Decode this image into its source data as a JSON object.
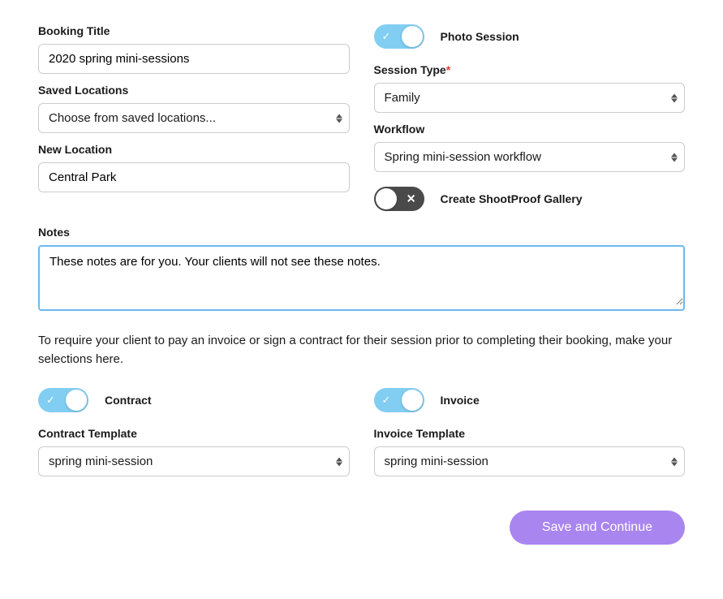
{
  "leftCol": {
    "bookingTitle": {
      "label": "Booking Title",
      "value": "2020 spring mini-sessions"
    },
    "savedLocations": {
      "label": "Saved Locations",
      "placeholder": "Choose from saved locations..."
    },
    "newLocation": {
      "label": "New Location",
      "value": "Central Park"
    }
  },
  "rightCol": {
    "photoSession": {
      "label": "Photo Session",
      "on": true
    },
    "sessionType": {
      "label": "Session Type",
      "required": true,
      "value": "Family"
    },
    "workflow": {
      "label": "Workflow",
      "value": "Spring mini-session workflow"
    },
    "shootproof": {
      "label": "Create ShootProof Gallery",
      "on": false
    }
  },
  "notes": {
    "label": "Notes",
    "value": "These notes are for you. Your clients will not see these notes."
  },
  "helpText": "To require your client to pay an invoice or sign a contract for their session prior to completing their booking, make your selections here.",
  "contract": {
    "toggleLabel": "Contract",
    "templateLabel": "Contract Template",
    "templateValue": "spring mini-session",
    "on": true
  },
  "invoice": {
    "toggleLabel": "Invoice",
    "templateLabel": "Invoice Template",
    "templateValue": "spring mini-session",
    "on": true
  },
  "footer": {
    "saveContinue": "Save and Continue"
  }
}
